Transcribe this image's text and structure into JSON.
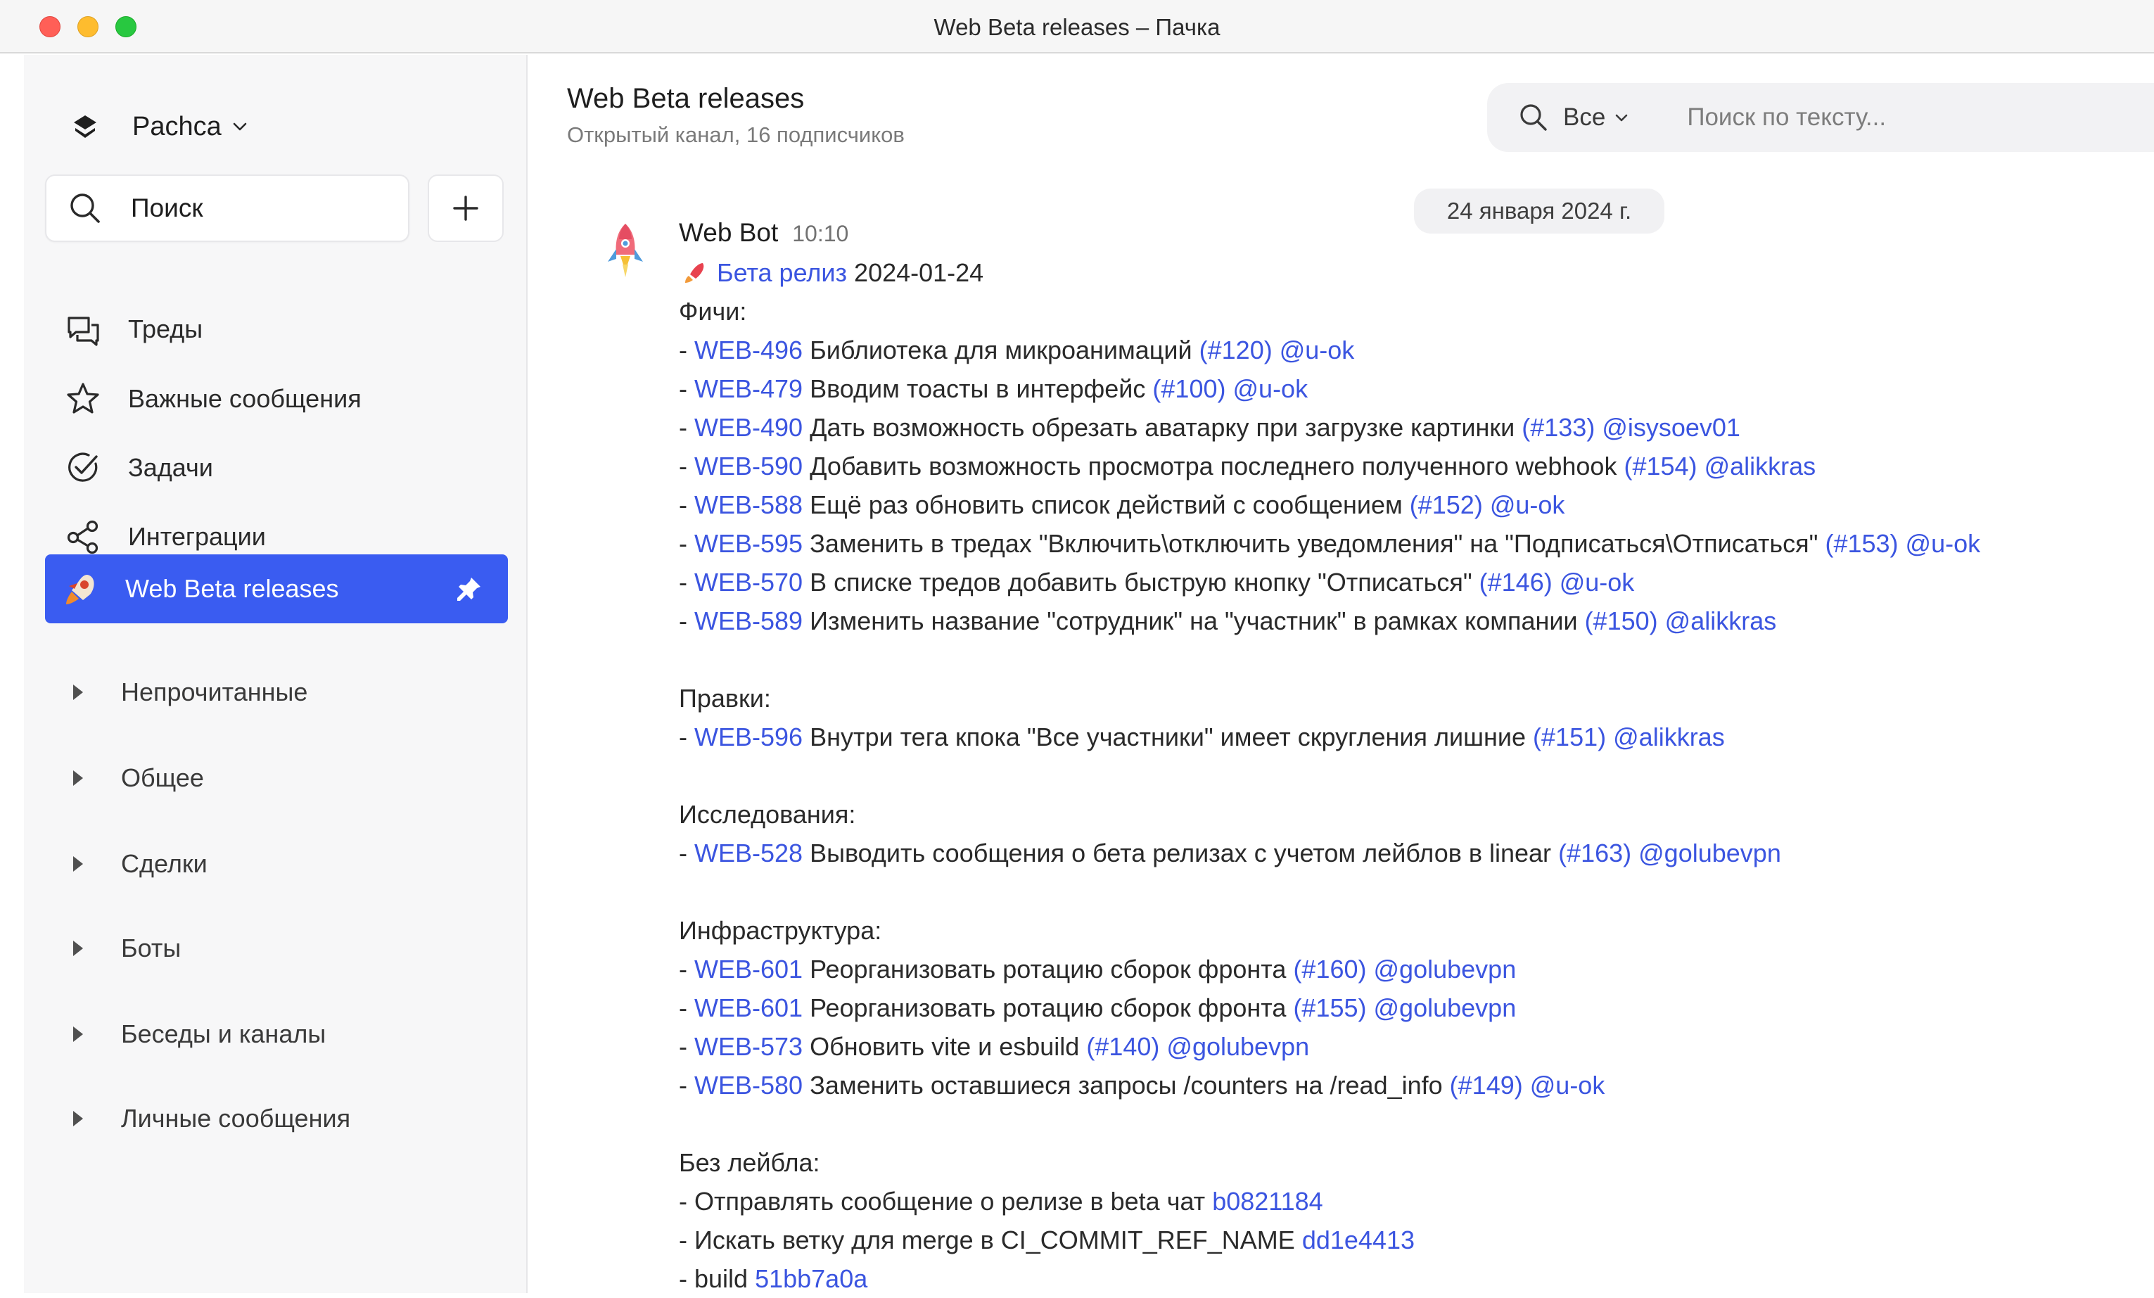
{
  "window": {
    "title": "Web Beta releases – Пачка"
  },
  "sidebar": {
    "workspace": "Pachca",
    "search_label": "Поиск",
    "nav": [
      {
        "label": "Треды",
        "icon": "threads-icon"
      },
      {
        "label": "Важные сообщения",
        "icon": "star-icon"
      },
      {
        "label": "Задачи",
        "icon": "check-circle-icon"
      },
      {
        "label": "Интеграции",
        "icon": "share-icon"
      }
    ],
    "active_channel": "Web Beta releases",
    "groups": [
      "Непрочитанные",
      "Общее",
      "Сделки",
      "Боты",
      "Беседы и каналы",
      "Личные сообщения"
    ]
  },
  "header": {
    "title": "Web Beta releases",
    "subtitle": "Открытый канал, 16 подписчиков",
    "search_scope": "Все",
    "search_placeholder": "Поиск по тексту..."
  },
  "date_separator": "24 января 2024 г.",
  "message": {
    "author": "Web Bot",
    "time": "10:10",
    "release_link": "Бета релиз",
    "release_date": "2024-01-24",
    "features_heading": "Фичи:",
    "features": [
      {
        "id": "WEB-496",
        "text": "Библиотека для микроанимаций",
        "pr": "(#120)",
        "user": "@u-ok"
      },
      {
        "id": "WEB-479",
        "text": "Вводим тоасты в интерфейс",
        "pr": "(#100)",
        "user": "@u-ok"
      },
      {
        "id": "WEB-490",
        "text": "Дать возможность обрезать аватарку при загрузке картинки",
        "pr": "(#133)",
        "user": "@isysoev01"
      },
      {
        "id": "WEB-590",
        "text": "Добавить возможность просмотра последнего полученного webhook",
        "pr": "(#154)",
        "user": "@alikkras"
      },
      {
        "id": "WEB-588",
        "text": "Ещё раз обновить список действий с сообщением",
        "pr": "(#152)",
        "user": "@u-ok"
      },
      {
        "id": "WEB-595",
        "text": "Заменить в тредах \"Включить\\отключить уведомления\" на \"Подписаться\\Отписаться\"",
        "pr": "(#153)",
        "user": "@u-ok"
      },
      {
        "id": "WEB-570",
        "text": "В списке тредов добавить быструю кнопку \"Отписаться\"",
        "pr": "(#146)",
        "user": "@u-ok"
      },
      {
        "id": "WEB-589",
        "text": "Изменить название \"сотрудник\" на \"участник\" в рамках компании",
        "pr": "(#150)",
        "user": "@alikkras"
      }
    ],
    "fixes_heading": "Правки:",
    "fixes": [
      {
        "id": "WEB-596",
        "text": "Внутри тега кпока \"Все участники\" имеет скругления лишние",
        "pr": "(#151)",
        "user": "@alikkras"
      }
    ],
    "research_heading": "Исследования:",
    "research": [
      {
        "id": "WEB-528",
        "text": "Выводить сообщения о бета релизах с учетом лейблов в linear",
        "pr": "(#163)",
        "user": "@golubevpn"
      }
    ],
    "infra_heading": "Инфраструктура:",
    "infra": [
      {
        "id": "WEB-601",
        "text": "Реорганизовать ротацию сборок фронта",
        "pr": "(#160)",
        "user": "@golubevpn"
      },
      {
        "id": "WEB-601",
        "text": "Реорганизовать ротацию сборок фронта",
        "pr": "(#155)",
        "user": "@golubevpn"
      },
      {
        "id": "WEB-573",
        "text": "Обновить vite и esbuild",
        "pr": "(#140)",
        "user": "@golubevpn"
      },
      {
        "id": "WEB-580",
        "text": "Заменить оставшиеся запросы /counters на /read_info",
        "pr": "(#149)",
        "user": "@u-ok"
      }
    ],
    "nolabel_heading": "Без лейбла:",
    "nolabel": [
      {
        "text": "Отправлять сообщение о релизе в beta чат",
        "hash": "b0821184"
      },
      {
        "text": "Искать ветку для merge в CI_COMMIT_REF_NAME",
        "hash": "dd1e4413"
      },
      {
        "text": "build",
        "hash": "51bb7a0a"
      }
    ]
  },
  "colors": {
    "accent": "#3a5cf1",
    "link": "#3b55e0",
    "sidebar_bg": "#f7f7f8"
  }
}
